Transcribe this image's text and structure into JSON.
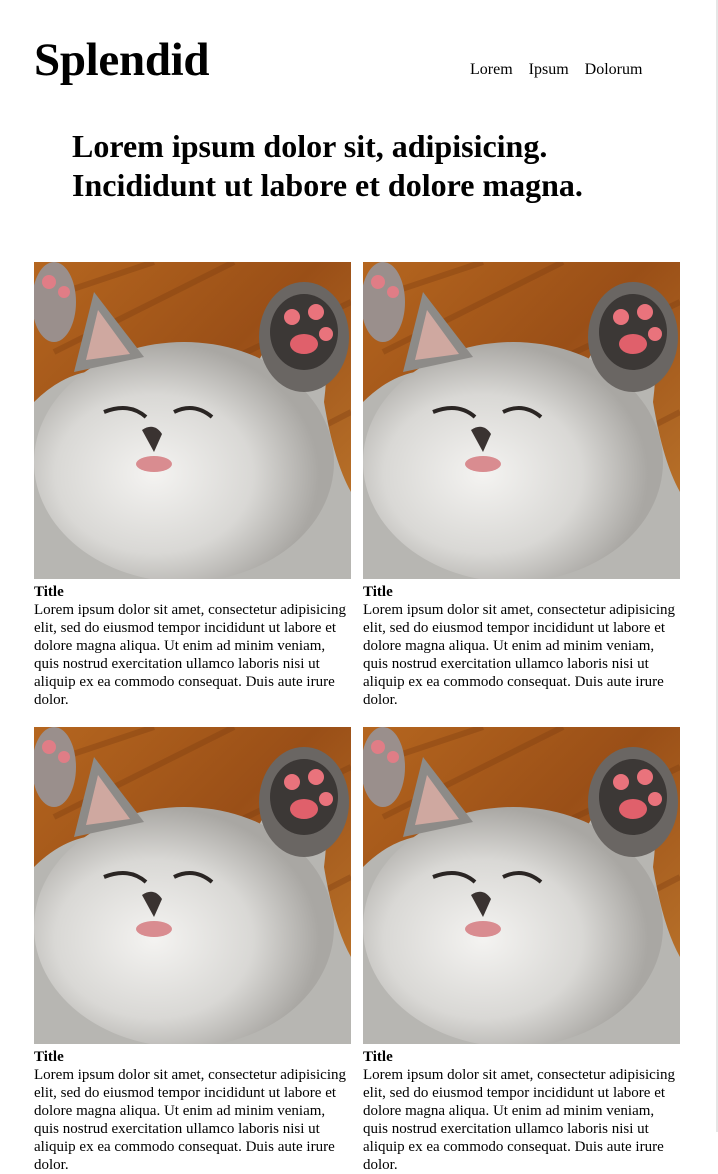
{
  "brand": "Splendid",
  "nav": {
    "items": [
      "Lorem",
      "Ipsum",
      "Dolorum"
    ]
  },
  "headline": "Lorem ipsum dolor sit, adipisicing. Incididunt ut labore et dolore magna.",
  "cards": [
    {
      "title": "Title",
      "text": "Lorem ipsum dolor sit amet, consectetur adipisicing elit, sed do eiusmod tempor incididunt ut labore et dolore magna aliqua. Ut enim ad minim veniam, quis nostrud exercitation ullamco laboris nisi ut aliquip ex ea commodo consequat. Duis aute irure dolor."
    },
    {
      "title": "Title",
      "text": "Lorem ipsum dolor sit amet, consectetur adipisicing elit, sed do eiusmod tempor incididunt ut labore et dolore magna aliqua. Ut enim ad minim veniam, quis nostrud exercitation ullamco laboris nisi ut aliquip ex ea commodo consequat. Duis aute irure dolor."
    },
    {
      "title": "Title",
      "text": "Lorem ipsum dolor sit amet, consectetur adipisicing elit, sed do eiusmod tempor incididunt ut labore et dolore magna aliqua. Ut enim ad minim veniam, quis nostrud exercitation ullamco laboris nisi ut aliquip ex ea commodo consequat. Duis aute irure dolor."
    },
    {
      "title": "Title",
      "text": "Lorem ipsum dolor sit amet, consectetur adipisicing elit, sed do eiusmod tempor incididunt ut labore et dolore magna aliqua. Ut enim ad minim veniam, quis nostrud exercitation ullamco laboris nisi ut aliquip ex ea commodo consequat. Duis aute irure dolor."
    }
  ],
  "colors": {
    "text": "#000000",
    "background": "#ffffff",
    "photo_wood": "#a65b1f",
    "photo_fur": "#d8d8d6"
  },
  "icons": {
    "card_image": "sleeping-kitten-photo"
  }
}
